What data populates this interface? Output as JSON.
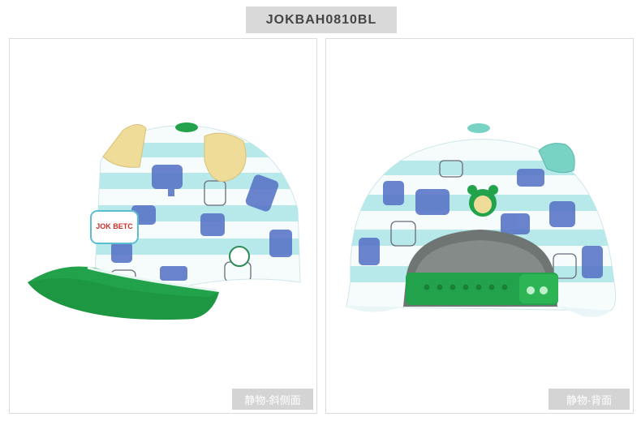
{
  "product_code": "JOKBAH0810BL",
  "panels": [
    {
      "caption": "静物-斜侧面",
      "view": "side"
    },
    {
      "caption": "静物-背面",
      "view": "back"
    }
  ],
  "badge_text": "JOK BETC",
  "colors": {
    "brim_green": "#22a24a",
    "stripe_aqua": "#b7e9ea",
    "elephant_blue": "#5a76c8",
    "ear_yellow": "#eedc98",
    "ear_mint": "#79d3c5"
  }
}
